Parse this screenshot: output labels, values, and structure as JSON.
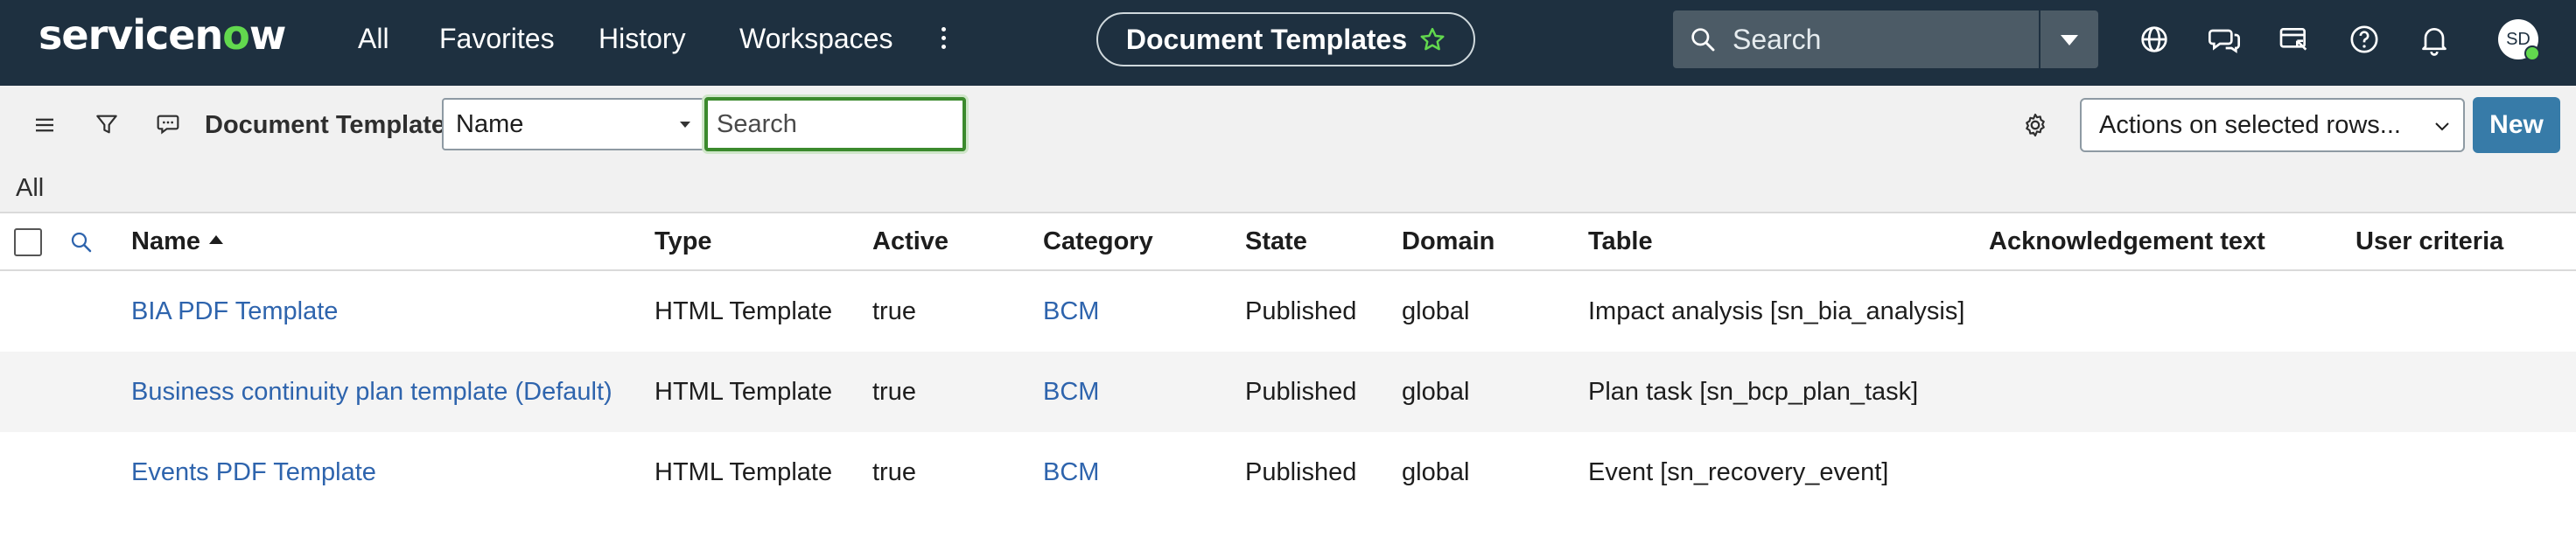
{
  "header": {
    "logo_text_pre": "servicen",
    "logo_text_o": "o",
    "logo_text_post": "w",
    "nav": [
      "All",
      "Favorites",
      "History",
      "Workspaces"
    ],
    "page_title": "Document Templates",
    "search_placeholder": "Search",
    "user_initials": "SD",
    "icons": [
      "globe-icon",
      "chat-icon",
      "screen-share-icon",
      "help-icon",
      "bell-icon"
    ]
  },
  "toolbar": {
    "list_title": "Document Templates",
    "field_value": "Name",
    "search_placeholder": "Search",
    "actions_label": "Actions on selected rows...",
    "new_label": "New"
  },
  "breadcrumb": "All",
  "table": {
    "columns": [
      "Name",
      "Type",
      "Active",
      "Category",
      "State",
      "Domain",
      "Table",
      "Acknowledgement text",
      "User criteria"
    ],
    "sort_column": "Name",
    "sort_direction": "ascending",
    "rows": [
      [
        "BIA PDF Template",
        "HTML Template",
        "true",
        "BCM",
        "Published",
        "global",
        "Impact analysis [sn_bia_analysis]",
        "",
        ""
      ],
      [
        "Business continuity plan template (Default)",
        "HTML Template",
        "true",
        "BCM",
        "Published",
        "global",
        "Plan task [sn_bcp_plan_task]",
        "",
        ""
      ],
      [
        "Events PDF Template",
        "HTML Template",
        "true",
        "BCM",
        "Published",
        "global",
        "Event [sn_recovery_event]",
        "",
        ""
      ]
    ]
  },
  "colors": {
    "header_bg": "#1e3040",
    "accent_green": "#62d84e",
    "link": "#2e64ad",
    "new_button": "#377ba8",
    "search_focus": "#3b8a2d"
  }
}
